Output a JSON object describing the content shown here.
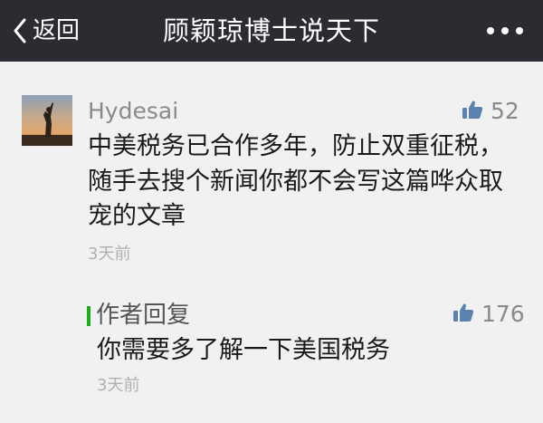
{
  "navbar": {
    "back_label": "返回",
    "title": "顾颖琼博士说天下",
    "back_icon": "chevron-left-icon",
    "more_icon": "more-dots-icon"
  },
  "comment": {
    "username": "Hydesai",
    "likes": "52",
    "text": "中美税务已合作多年，防止双重征税，随手去搜个新闻你都不会写这篇哗众取宠的文章",
    "time": "3天前",
    "like_icon": "thumbs-up-icon"
  },
  "reply": {
    "label": "作者回复",
    "likes": "176",
    "text": "你需要多了解一下美国税务",
    "time": "3天前",
    "accent": "#1aad19"
  }
}
